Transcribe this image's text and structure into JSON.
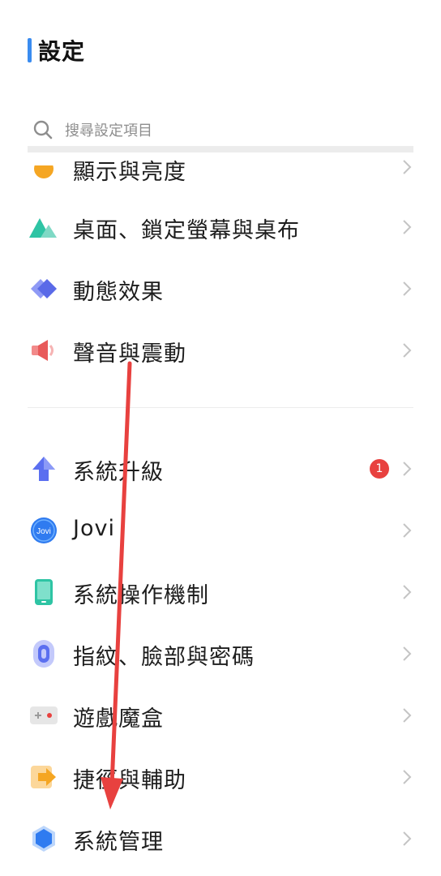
{
  "header": {
    "title": "設定"
  },
  "search": {
    "placeholder": "搜尋設定項目"
  },
  "settings_group_1": [
    {
      "label": "顯示與亮度",
      "icon": "display-icon"
    },
    {
      "label": "桌面、鎖定螢幕與桌布",
      "icon": "wallpaper-icon"
    },
    {
      "label": "動態效果",
      "icon": "animation-icon"
    },
    {
      "label": "聲音與震動",
      "icon": "sound-icon"
    }
  ],
  "settings_group_2": [
    {
      "label": "系統升級",
      "icon": "upgrade-icon",
      "badge": "1"
    },
    {
      "label": "Jovi",
      "icon": "jovi-icon",
      "icon_text": "Jovi"
    },
    {
      "label": "系統操作機制",
      "icon": "phone-icon"
    },
    {
      "label": "指紋、臉部與密碼",
      "icon": "fingerprint-icon"
    },
    {
      "label": "遊戲魔盒",
      "icon": "game-icon"
    },
    {
      "label": "捷徑與輔助",
      "icon": "shortcut-icon"
    },
    {
      "label": "系統管理",
      "icon": "system-management-icon"
    }
  ],
  "colors": {
    "accent": "#3a8cf0",
    "annotation_arrow": "#e8413f"
  }
}
